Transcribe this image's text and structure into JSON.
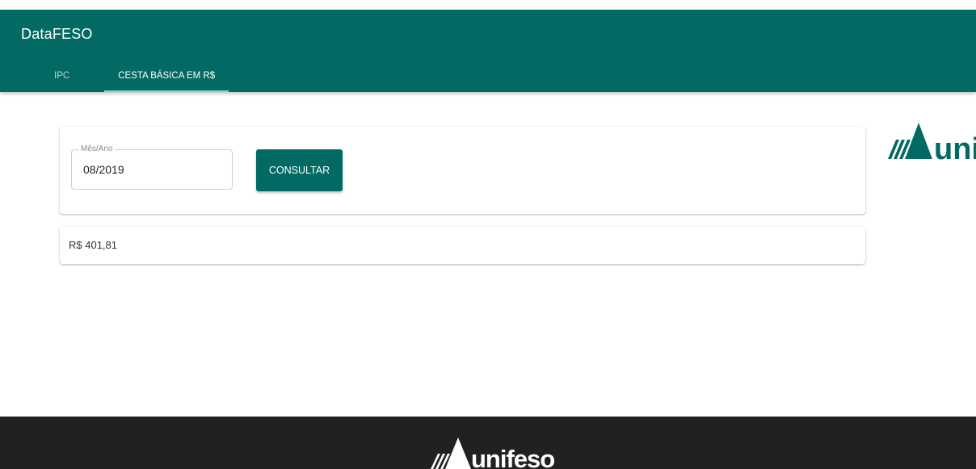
{
  "app": {
    "title": "DataFESO",
    "brand_color": "#026a63",
    "accent_color": "#7fd6c7"
  },
  "tabs": [
    {
      "label": "IPC",
      "active": false
    },
    {
      "label": "CESTA BÁSICA EM R$",
      "active": true
    }
  ],
  "form": {
    "field_label": "Mês/Ano",
    "field_value": "08/2019",
    "submit_label": "CONSULTAR"
  },
  "result": {
    "value": "R$ 401,81"
  },
  "logos": {
    "side_logo_text": "uni",
    "footer_logo_text": "unifeso",
    "icon": "unifeso-mountain-logo"
  }
}
